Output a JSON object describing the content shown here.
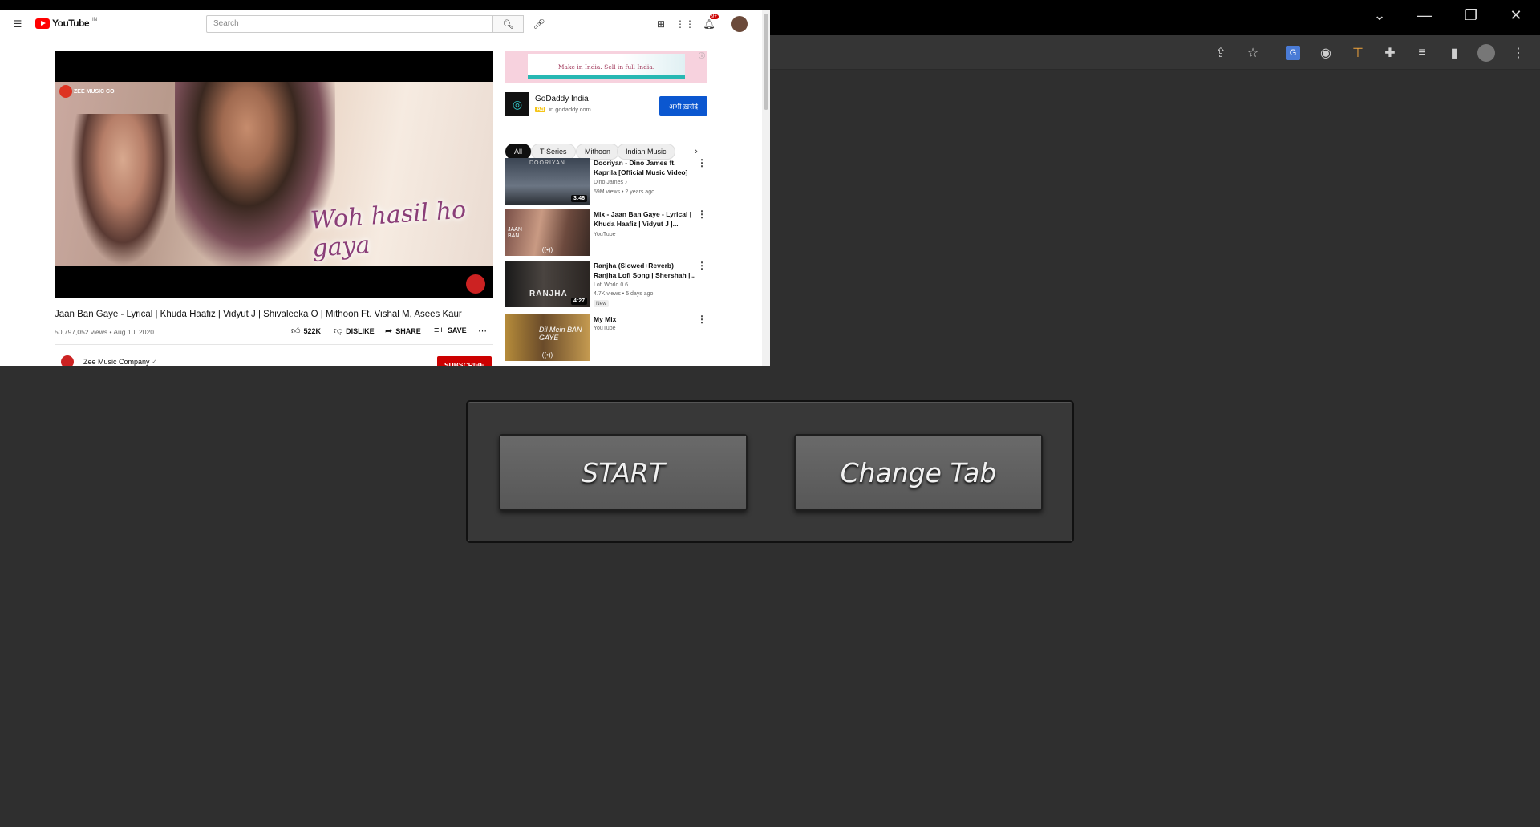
{
  "window": {
    "minimize": "—",
    "restore": "❐",
    "close": "✕",
    "tabs_dropdown": "⌄"
  },
  "youtube": {
    "logo_text": "YouTube",
    "region": "IN",
    "search": {
      "placeholder": "Search"
    },
    "notification_count": "9+",
    "video": {
      "watermark": "ZEE MUSIC CO.",
      "lyric": "Woh hasil ho gaya",
      "title": "Jaan Ban Gaye - Lyrical | Khuda Haafiz | Vidyut J | Shivaleeka O | Mithoon Ft. Vishal M, Asees Kaur",
      "meta": "50,797,052 views • Aug 10, 2020",
      "likes": "522K",
      "dislike": "DISLIKE",
      "share": "SHARE",
      "save": "SAVE"
    },
    "channel": {
      "name": "Zee Music Company",
      "verified": "✓",
      "subscribe": "SUBSCRIBE"
    },
    "ad": {
      "banner_text": "Make in India. Sell in full India.",
      "advertiser": "GoDaddy India",
      "badge": "Ad",
      "domain": "in.godaddy.com",
      "cta": "अभी ख़रीदें"
    },
    "chips": [
      "All",
      "T-Series",
      "Mithoon",
      "Indian Music"
    ],
    "recommendations": [
      {
        "title": "Dooriyan - Dino James ft. Kaprila [Official Music Video]",
        "channel": "Dino James ♪",
        "meta": "59M views • 2 years ago",
        "duration": "3:46",
        "thumb_text": "DOORIYAN"
      },
      {
        "title": "Mix - Jaan Ban Gaye - Lyrical | Khuda Haafiz | Vidyut J |...",
        "channel": "YouTube",
        "meta": "",
        "duration": "((•))",
        "thumb_text": "JAAN BAN"
      },
      {
        "title": "Ranjha (Slowed+Reverb) Ranjha Lofi Song | Shershah |...",
        "channel": "Lofi World 0.6",
        "meta": "4.7K views • 5 days ago",
        "badge": "New",
        "duration": "4:27",
        "thumb_text": "RANJHA"
      },
      {
        "title": "My Mix",
        "channel": "YouTube",
        "meta": "",
        "duration": "((•))",
        "thumb_text": "Dil Mein BAN GAYE"
      }
    ]
  },
  "panel": {
    "start": "START",
    "change_tab": "Change Tab"
  }
}
